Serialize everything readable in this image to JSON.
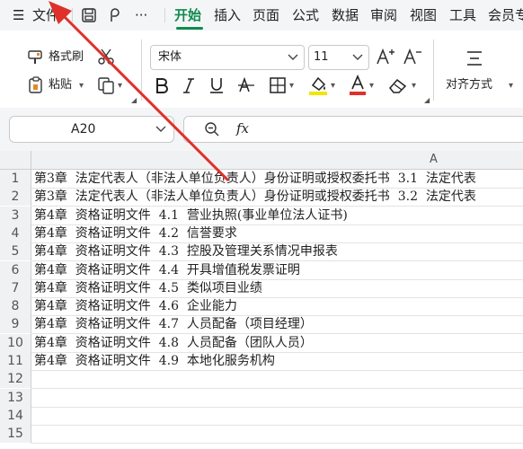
{
  "menu": {
    "file": "文件",
    "more": "···",
    "tabs": [
      "开始",
      "插入",
      "页面",
      "公式",
      "数据",
      "审阅",
      "视图",
      "工具",
      "会员专"
    ]
  },
  "ribbon": {
    "format_painter": "格式刷",
    "paste": "粘贴",
    "font_name": "宋体",
    "font_size": "11",
    "align": "对齐方式"
  },
  "formula_bar": {
    "cell_ref": "A20",
    "fx": "fx",
    "formula": ""
  },
  "sheet": {
    "columns": [
      "A"
    ],
    "row_numbers": [
      "1",
      "2",
      "3",
      "4",
      "5",
      "6",
      "7",
      "8",
      "9",
      "10",
      "11",
      "12",
      "13",
      "14",
      "15"
    ],
    "cells": [
      "第3章  法定代表人（非法人单位负责人）身份证明或授权委托书  3.1  法定代表",
      "第3章  法定代表人（非法人单位负责人）身份证明或授权委托书  3.2  法定代表",
      "第4章  资格证明文件  4.1  营业执照(事业单位法人证书)",
      "第4章  资格证明文件  4.2  信誉要求",
      "第4章  资格证明文件  4.3  控股及管理关系情况申报表",
      "第4章  资格证明文件  4.4  开具增值税发票证明",
      "第4章  资格证明文件  4.5  类似项目业绩",
      "第4章  资格证明文件  4.6  企业能力",
      "第4章  资格证明文件  4.7  人员配备（项目经理）",
      "第4章  资格证明文件  4.8  人员配备（团队人员）",
      "第4章  资格证明文件  4.9  本地化服务机构",
      "",
      "",
      "",
      ""
    ]
  },
  "colors": {
    "accent": "#0f8b4e",
    "arrow": "#e0302a",
    "font_color_bar": "#e0302a",
    "highlight_bar": "#f5e400"
  }
}
